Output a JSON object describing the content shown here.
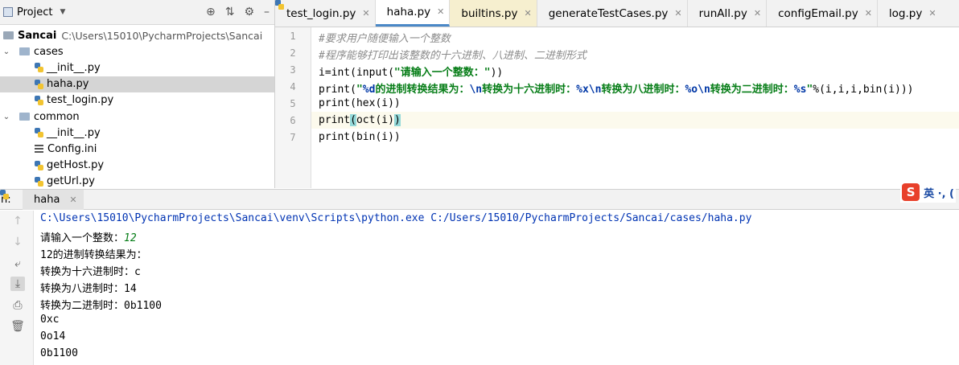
{
  "project_panel": {
    "title": "Project",
    "tree": [
      {
        "name": "Sancai",
        "path": "C:\\Users\\15010\\PycharmProjects\\Sancai",
        "type": "root"
      },
      {
        "name": "cases",
        "type": "folder"
      },
      {
        "name": "__init__.py",
        "type": "py"
      },
      {
        "name": "haha.py",
        "type": "py",
        "selected": true
      },
      {
        "name": "test_login.py",
        "type": "py"
      },
      {
        "name": "common",
        "type": "folder"
      },
      {
        "name": "__init__.py",
        "type": "py"
      },
      {
        "name": "Config.ini",
        "type": "ini"
      },
      {
        "name": "getHost.py",
        "type": "py"
      },
      {
        "name": "getUrl.py",
        "type": "py"
      }
    ]
  },
  "tabs": [
    {
      "label": "test_login.py"
    },
    {
      "label": "haha.py",
      "active": true
    },
    {
      "label": "builtins.py"
    },
    {
      "label": "generateTestCases.py"
    },
    {
      "label": "runAll.py"
    },
    {
      "label": "configEmail.py"
    },
    {
      "label": "log.py"
    }
  ],
  "editor": {
    "line_numbers": [
      "1",
      "2",
      "3",
      "4",
      "5",
      "6",
      "7"
    ],
    "lines": {
      "l1": "#要求用户随便输入一个整数",
      "l2": "#程序能够打印出该整数的十六进制、八进制、二进制形式",
      "l3_a": "i=int(input(",
      "l3_str": "\"请输入一个整数：\"",
      "l3_b": "))",
      "l4_a": "print(",
      "l4_s1": "\"",
      "l4_f1": "%d",
      "l4_s2": "的进制转换结果为：",
      "l4_f2": "\\n",
      "l4_s3": "转换为十六进制时：",
      "l4_f3": "%x\\n",
      "l4_s4": "转换为八进制时：",
      "l4_f4": "%o\\n",
      "l4_s5": "转换为二进制时：",
      "l4_f5": "%s",
      "l4_s6": "\"",
      "l4_b": "%(i,i,i,bin(i)))",
      "l5": "print(hex(i))",
      "l6_a": "print",
      "l6_b1": "(",
      "l6_mid": "oct(i)",
      "l6_b2": ")",
      "l7": "print(bin(i))"
    }
  },
  "run": {
    "label": "n:",
    "tab_label": "haha",
    "ime": {
      "text": "英 ·, ("
    },
    "console": {
      "cmd": "C:\\Users\\15010\\PycharmProjects\\Sancai\\venv\\Scripts\\python.exe C:/Users/15010/PycharmProjects/Sancai/cases/haha.py",
      "prompt": "请输入一个整数：",
      "input": "12",
      "out1": "12的进制转换结果为：",
      "out2": "转换为十六进制时：c",
      "out3": "转换为八进制时：14",
      "out4": "转换为二进制时：0b1100",
      "out5": "0xc",
      "out6": "0o14",
      "out7": "0b1100"
    }
  }
}
